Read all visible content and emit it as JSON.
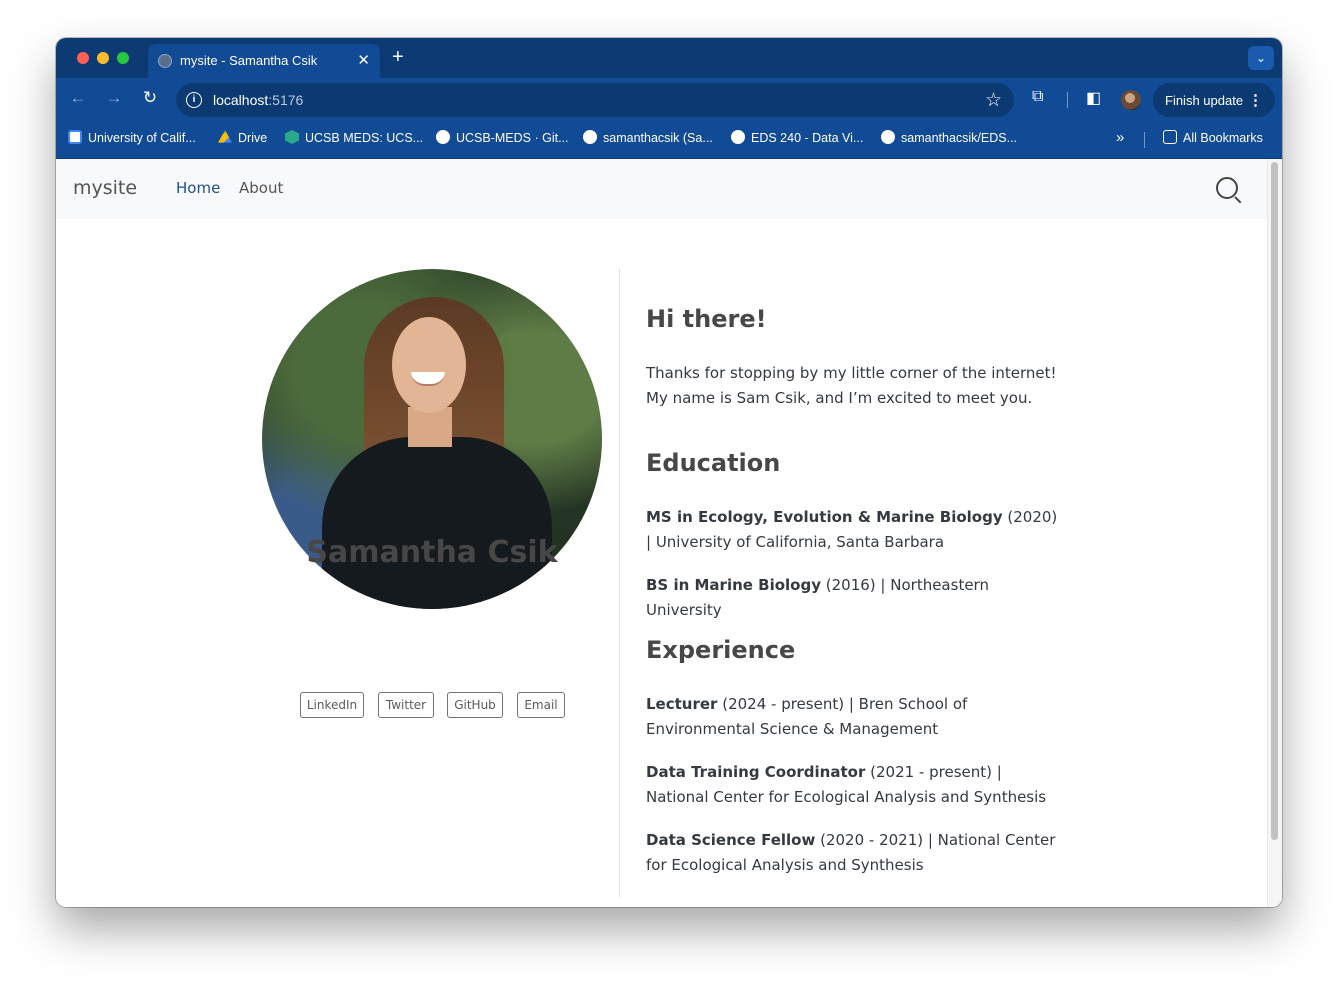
{
  "browser": {
    "tab_title": "mysite - Samantha Csik",
    "url_host": "localhost",
    "url_port": ":5176",
    "finish_update_label": "Finish update",
    "bookmarks": [
      {
        "label": "University of Calif...",
        "icon": "calendar-icon"
      },
      {
        "label": "Drive",
        "icon": "drive-icon"
      },
      {
        "label": "UCSB MEDS: UCS...",
        "icon": "meds-icon"
      },
      {
        "label": "UCSB-MEDS · Git...",
        "icon": "github-icon"
      },
      {
        "label": "samanthacsik (Sa...",
        "icon": "github-icon"
      },
      {
        "label": "EDS 240 - Data Vi...",
        "icon": "globe-icon"
      },
      {
        "label": "samanthacsik/EDS...",
        "icon": "github-icon"
      }
    ],
    "all_bookmarks_label": "All Bookmarks"
  },
  "site": {
    "brand": "mysite",
    "nav": [
      {
        "label": "Home",
        "active": true
      },
      {
        "label": "About",
        "active": false
      }
    ]
  },
  "profile": {
    "name": "Samantha Csik",
    "links": [
      "LinkedIn",
      "Twitter",
      "GitHub",
      "Email"
    ]
  },
  "content": {
    "greeting_heading": "Hi there!",
    "intro": "Thanks for stopping by my little corner of the internet! My name is Sam Csik, and I’m excited to meet you.",
    "education_heading": "Education",
    "education": [
      {
        "degree": "MS in Ecology, Evolution & Marine Biology",
        "detail": " (2020) | University of California, Santa Barbara"
      },
      {
        "degree": "BS in Marine Biology",
        "detail": " (2016) | Northeastern University"
      }
    ],
    "experience_heading": "Experience",
    "experience": [
      {
        "role": "Lecturer",
        "detail": " (2024 - present) | Bren School of Environmental Science & Management"
      },
      {
        "role": "Data Training Coordinator",
        "detail": " (2021 - present) | National Center for Ecological Analysis and Synthesis"
      },
      {
        "role": "Data Science Fellow",
        "detail": " (2020 - 2021) | National Center for Ecological Analysis and Synthesis"
      }
    ]
  },
  "colors": {
    "browser_frame": "#114a95",
    "tab_strip": "#0c3b73",
    "nav_active": "#1f4e8c",
    "text": "#343a40"
  }
}
